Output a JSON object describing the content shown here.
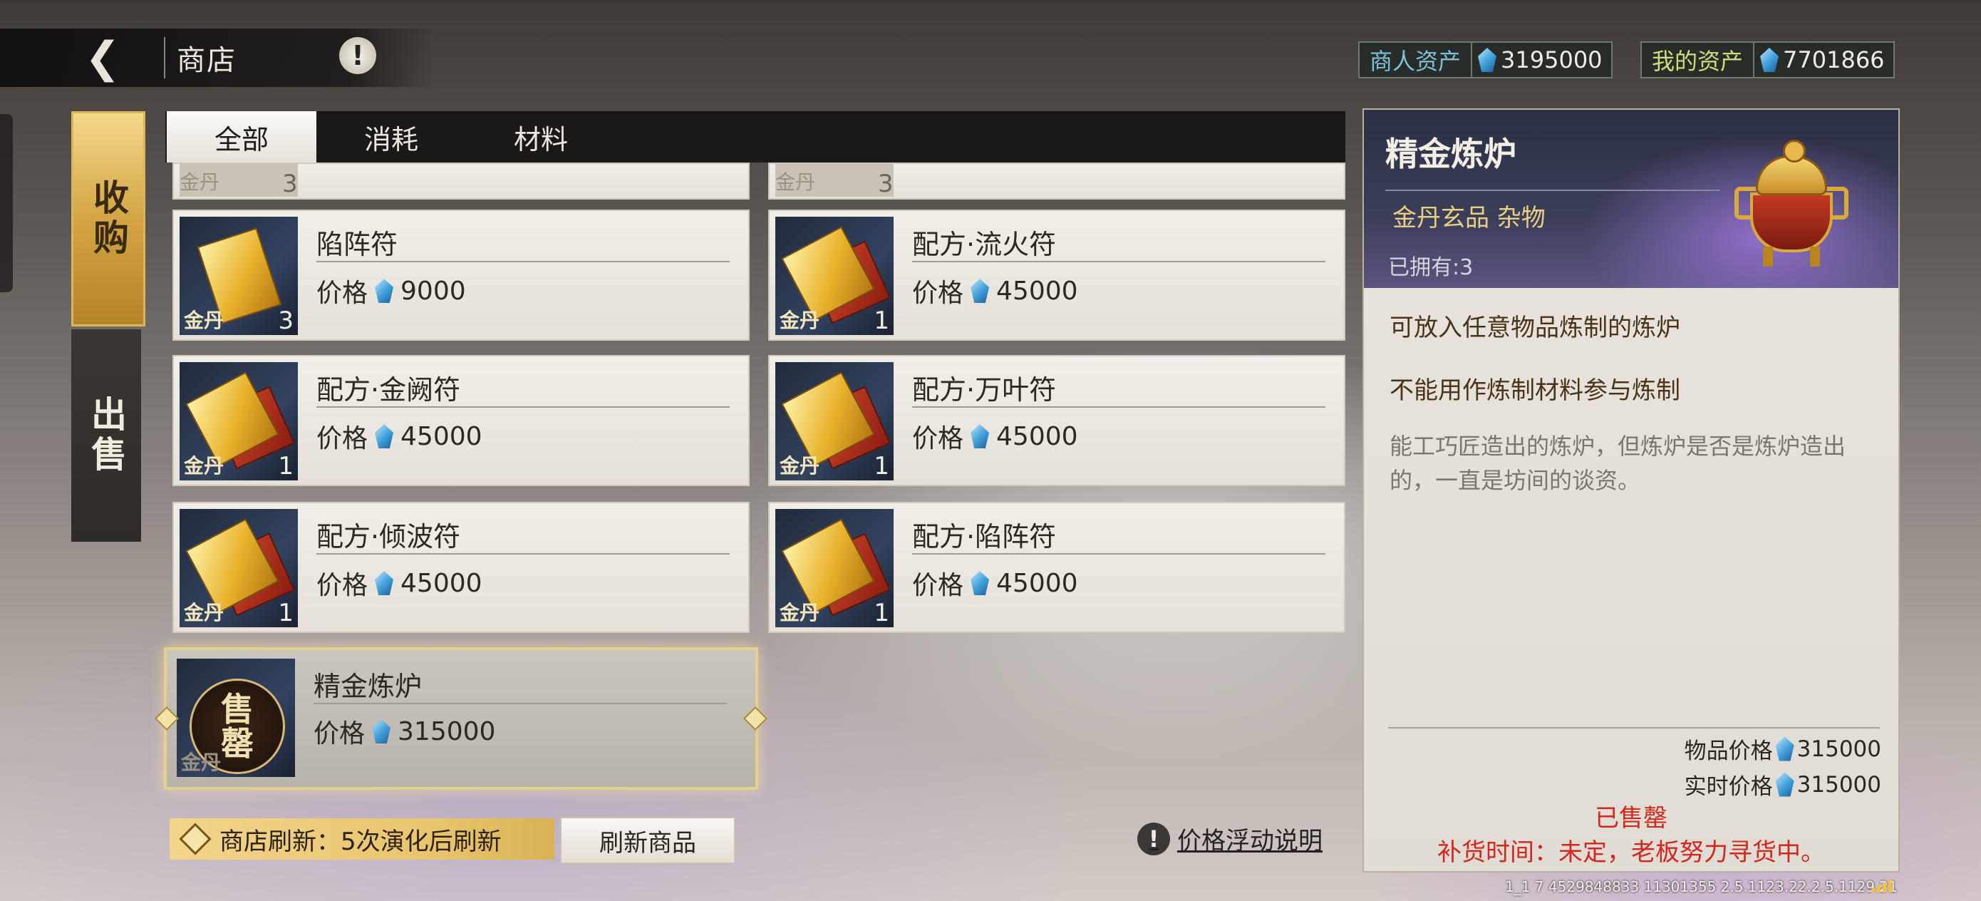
{
  "header": {
    "title": "商店",
    "info_icon": "!"
  },
  "assets": {
    "merchant_label": "商人资产",
    "merchant_value": "3195000",
    "mine_label": "我的资产",
    "mine_value": "7701866",
    "merchant_label_color": "#7fc1d8",
    "mine_label_color": "#c9e07a"
  },
  "side_tabs": {
    "buy": "收购",
    "sell": "出售",
    "active": "buy"
  },
  "category_tabs": [
    {
      "label": "全部",
      "active": true
    },
    {
      "label": "消耗",
      "active": false
    },
    {
      "label": "材料",
      "active": false
    }
  ],
  "partial_items": [
    {
      "grade": "金丹",
      "count": "3"
    },
    {
      "grade": "金丹",
      "count": "3"
    }
  ],
  "items": [
    {
      "name": "陷阵符",
      "price_label": "价格",
      "price": "9000",
      "grade": "金丹",
      "count": "3"
    },
    {
      "name": "配方·流火符",
      "price_label": "价格",
      "price": "45000",
      "grade": "金丹",
      "count": "1"
    },
    {
      "name": "配方·金阙符",
      "price_label": "价格",
      "price": "45000",
      "grade": "金丹",
      "count": "1"
    },
    {
      "name": "配方·万叶符",
      "price_label": "价格",
      "price": "45000",
      "grade": "金丹",
      "count": "1"
    },
    {
      "name": "配方·倾波符",
      "price_label": "价格",
      "price": "45000",
      "grade": "金丹",
      "count": "1"
    },
    {
      "name": "配方·陷阵符",
      "price_label": "价格",
      "price": "45000",
      "grade": "金丹",
      "count": "1"
    }
  ],
  "selected_item": {
    "name": "精金炼炉",
    "price_label": "价格",
    "price": "315000",
    "grade": "金丹",
    "stamp_top": "售",
    "stamp_bottom": "罄"
  },
  "footer": {
    "refresh_text": "商店刷新：5次演化后刷新",
    "refresh_button": "刷新商品",
    "price_help": "价格浮动说明",
    "price_help_icon": "!"
  },
  "detail": {
    "name": "精金炼炉",
    "category": "金丹玄品  杂物",
    "owned": "已拥有:3",
    "desc1": "可放入任意物品炼制的炼炉",
    "desc2": "不能用作炼制材料参与炼制",
    "flavor": "能工巧匠造出的炼炉，但炼炉是否是炼炉造出的，一直是坊间的谈资。",
    "item_price_label": "物品价格",
    "item_price": "315000",
    "realtime_price_label": "实时价格",
    "realtime_price": "315000",
    "sold_out": "已售罄",
    "restock": "补货时间：未定，老板努力寻货中。"
  },
  "debug_text": "1_1 7 4529848833 11301355 2.5.1123.22.2.5.1129.21"
}
